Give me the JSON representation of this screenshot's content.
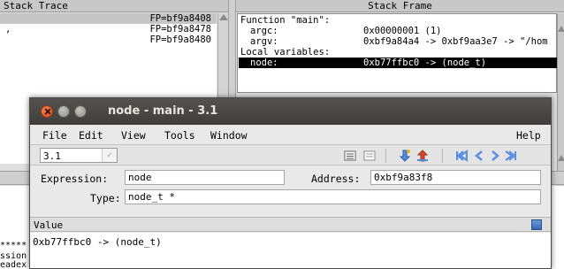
{
  "stack_trace": {
    "title": "Stack Trace",
    "rows": [
      {
        "mark": "",
        "fp": "FP=bf9a8408",
        "selected": true
      },
      {
        "mark": ",",
        "fp": "FP=bf9a8478",
        "selected": false
      },
      {
        "mark": "",
        "fp": "FP=bf9a8480",
        "selected": false
      }
    ]
  },
  "stack_frame": {
    "title": "Stack Frame",
    "function_header": "Function \"main\":",
    "args": [
      {
        "name": "argc:",
        "value": "0x00000001 (1)"
      },
      {
        "name": "argv:",
        "value": "0xbf9a84a4 -> 0xbf9aa3e7 -> \"/hom"
      }
    ],
    "locals_header": "Local variables:",
    "locals": [
      {
        "name": "node:",
        "value": "0xb77ffbc0 -> (node_t)"
      }
    ]
  },
  "lower_pane_left": [
    "***** ",
    "ssion",
    "eadex"
  ],
  "data_window": {
    "title": "node - main - 3.1",
    "menu": {
      "file": "File",
      "edit": "Edit",
      "view": "View",
      "tools": "Tools",
      "window": "Window",
      "help": "Help"
    },
    "toolbar": {
      "combo_value": "3.1"
    },
    "expression_label": "Expression:",
    "expression_value": "node",
    "address_label": "Address:",
    "address_value": "0xbf9a83f8",
    "type_label": "Type:",
    "type_value": "node_t *",
    "value_header": "Value",
    "value": "0xb77ffbc0 -> (node_t)"
  }
}
